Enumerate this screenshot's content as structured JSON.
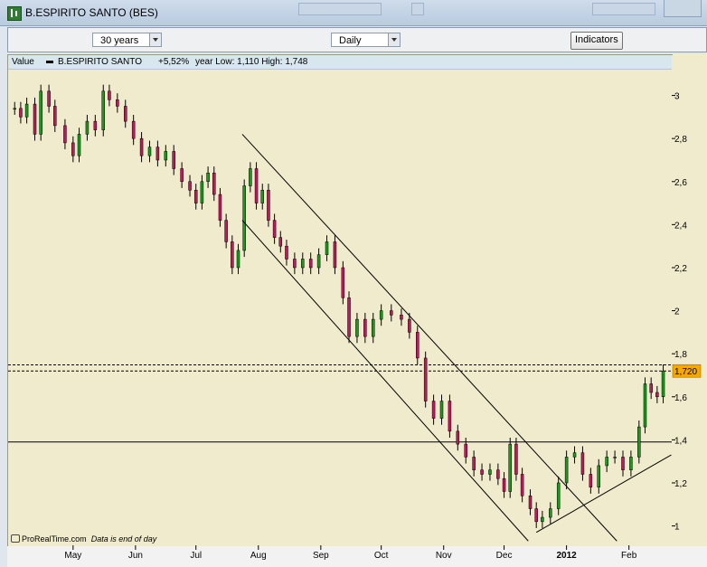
{
  "window": {
    "title": "B.ESPIRITO SANTO (BES)"
  },
  "toolbar": {
    "period": "30 years",
    "interval": "Daily",
    "indicators_label": "Indicators"
  },
  "legend": {
    "value_label": "Value",
    "series_name": "B.ESPIRITO SANTO",
    "change": "+5,52%",
    "stats": "year Low: 1,110 High: 1,748"
  },
  "footer": {
    "brand": "ProRealTime.com",
    "note": "Data is end of day"
  },
  "colors": {
    "up": "#1a9a1a",
    "down": "#c2185b",
    "background": "#f0ebcc",
    "current_price_box": "#f5a800"
  },
  "chart_data": {
    "type": "candlestick",
    "ylim": [
      0.91,
      3.12
    ],
    "yticks": [
      "3",
      "2,8",
      "2,6",
      "2,4",
      "2,2",
      "2",
      "1,8",
      "1,6",
      "1,4",
      "1,2",
      "1"
    ],
    "ytick_values": [
      3.0,
      2.8,
      2.6,
      2.4,
      2.2,
      2.0,
      1.8,
      1.6,
      1.4,
      1.2,
      1.0
    ],
    "xticks": [
      "May",
      "Jun",
      "Jul",
      "Aug",
      "Sep",
      "Oct",
      "Nov",
      "Dec",
      "2012",
      "Feb"
    ],
    "xtick_dates": [
      "2011-05-01",
      "2011-06-01",
      "2011-07-01",
      "2011-08-01",
      "2011-09-01",
      "2011-10-01",
      "2011-11-01",
      "2011-12-01",
      "2012-01-01",
      "2012-02-01"
    ],
    "x_range": [
      "2011-04-01",
      "2012-02-20"
    ],
    "current_value": "1,720",
    "current_value_num": 1.72,
    "horizontal_lines": [
      1.748,
      1.72,
      1.39
    ],
    "close_series": [
      [
        "2011-04-02",
        2.94
      ],
      [
        "2011-04-05",
        2.9
      ],
      [
        "2011-04-08",
        2.96
      ],
      [
        "2011-04-12",
        2.82
      ],
      [
        "2011-04-15",
        3.02
      ],
      [
        "2011-04-19",
        2.95
      ],
      [
        "2011-04-22",
        2.86
      ],
      [
        "2011-04-27",
        2.78
      ],
      [
        "2011-05-01",
        2.72
      ],
      [
        "2011-05-04",
        2.82
      ],
      [
        "2011-05-08",
        2.88
      ],
      [
        "2011-05-12",
        2.84
      ],
      [
        "2011-05-16",
        3.02
      ],
      [
        "2011-05-19",
        2.98
      ],
      [
        "2011-05-23",
        2.95
      ],
      [
        "2011-05-27",
        2.88
      ],
      [
        "2011-05-31",
        2.8
      ],
      [
        "2011-06-04",
        2.72
      ],
      [
        "2011-06-08",
        2.76
      ],
      [
        "2011-06-12",
        2.7
      ],
      [
        "2011-06-16",
        2.74
      ],
      [
        "2011-06-20",
        2.66
      ],
      [
        "2011-06-24",
        2.6
      ],
      [
        "2011-06-28",
        2.56
      ],
      [
        "2011-07-01",
        2.5
      ],
      [
        "2011-07-04",
        2.6
      ],
      [
        "2011-07-07",
        2.64
      ],
      [
        "2011-07-10",
        2.54
      ],
      [
        "2011-07-13",
        2.42
      ],
      [
        "2011-07-16",
        2.32
      ],
      [
        "2011-07-19",
        2.2
      ],
      [
        "2011-07-22",
        2.28
      ],
      [
        "2011-07-25",
        2.58
      ],
      [
        "2011-07-28",
        2.66
      ],
      [
        "2011-07-31",
        2.5
      ],
      [
        "2011-08-03",
        2.56
      ],
      [
        "2011-08-06",
        2.42
      ],
      [
        "2011-08-09",
        2.34
      ],
      [
        "2011-08-12",
        2.3
      ],
      [
        "2011-08-15",
        2.24
      ],
      [
        "2011-08-19",
        2.2
      ],
      [
        "2011-08-23",
        2.24
      ],
      [
        "2011-08-27",
        2.2
      ],
      [
        "2011-08-31",
        2.26
      ],
      [
        "2011-09-04",
        2.32
      ],
      [
        "2011-09-08",
        2.2
      ],
      [
        "2011-09-12",
        2.06
      ],
      [
        "2011-09-15",
        1.88
      ],
      [
        "2011-09-19",
        1.96
      ],
      [
        "2011-09-23",
        1.88
      ],
      [
        "2011-09-27",
        1.96
      ],
      [
        "2011-10-01",
        2.0
      ],
      [
        "2011-10-06",
        1.98
      ],
      [
        "2011-10-11",
        1.96
      ],
      [
        "2011-10-15",
        1.9
      ],
      [
        "2011-10-19",
        1.78
      ],
      [
        "2011-10-23",
        1.58
      ],
      [
        "2011-10-27",
        1.5
      ],
      [
        "2011-10-31",
        1.58
      ],
      [
        "2011-11-04",
        1.44
      ],
      [
        "2011-11-08",
        1.38
      ],
      [
        "2011-11-12",
        1.32
      ],
      [
        "2011-11-16",
        1.26
      ],
      [
        "2011-11-20",
        1.24
      ],
      [
        "2011-11-24",
        1.26
      ],
      [
        "2011-11-28",
        1.22
      ],
      [
        "2011-12-01",
        1.16
      ],
      [
        "2011-12-04",
        1.38
      ],
      [
        "2011-12-07",
        1.24
      ],
      [
        "2011-12-10",
        1.14
      ],
      [
        "2011-12-14",
        1.08
      ],
      [
        "2011-12-17",
        1.02
      ],
      [
        "2011-12-20",
        1.04
      ],
      [
        "2011-12-24",
        1.08
      ],
      [
        "2011-12-28",
        1.2
      ],
      [
        "2012-01-01",
        1.32
      ],
      [
        "2012-01-05",
        1.34
      ],
      [
        "2012-01-09",
        1.24
      ],
      [
        "2012-01-13",
        1.18
      ],
      [
        "2012-01-17",
        1.28
      ],
      [
        "2012-01-21",
        1.32
      ],
      [
        "2012-01-25",
        1.32
      ],
      [
        "2012-01-29",
        1.26
      ],
      [
        "2012-02-02",
        1.32
      ],
      [
        "2012-02-06",
        1.46
      ],
      [
        "2012-02-09",
        1.66
      ],
      [
        "2012-02-12",
        1.62
      ],
      [
        "2012-02-15",
        1.6
      ],
      [
        "2012-02-18",
        1.72
      ]
    ],
    "trendlines": [
      {
        "name": "channel-upper",
        "from": [
          "2011-07-24",
          2.82
        ],
        "to": [
          "2012-01-26",
          0.93
        ]
      },
      {
        "name": "channel-lower",
        "from": [
          "2011-07-24",
          2.42
        ],
        "to": [
          "2011-12-13",
          0.93
        ]
      },
      {
        "name": "support-rising",
        "from": [
          "2011-12-17",
          0.97
        ],
        "to": [
          "2012-02-22",
          1.33
        ]
      }
    ]
  }
}
